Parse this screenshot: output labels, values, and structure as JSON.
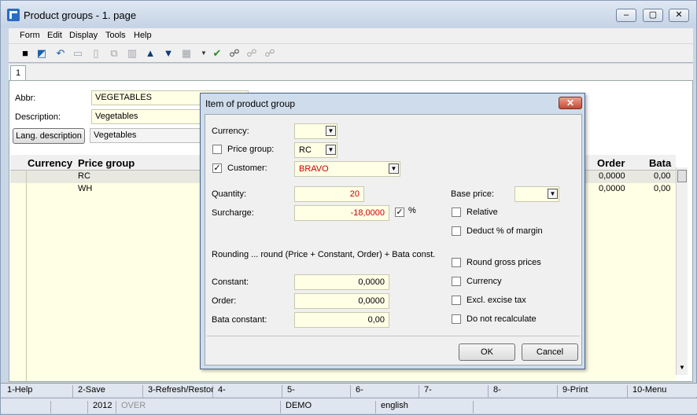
{
  "window": {
    "title": "Product groups - 1. page"
  },
  "menu": [
    "Form",
    "Edit",
    "Display",
    "Tools",
    "Help"
  ],
  "tab": "1",
  "form": {
    "abbr_label": "Abbr:",
    "abbr_value": "VEGETABLES",
    "description_label": "Description:",
    "description_value": "Vegetables",
    "lang_button": "Lang. description",
    "lang_value": "Vegetables"
  },
  "grid": {
    "columns": {
      "currency": "Currency",
      "price_group": "Price group",
      "order": "Order",
      "bata": "Bata"
    },
    "rows": [
      {
        "price_group": "RC",
        "order": "0,0000",
        "bata": "0,00"
      },
      {
        "price_group": "WH",
        "order": "0,0000",
        "bata": "0,00"
      }
    ]
  },
  "dialog": {
    "title": "Item of product group",
    "currency_label": "Currency:",
    "currency_value": "",
    "price_group_label": "Price group:",
    "price_group_value": "RC",
    "customer_label": "Customer:",
    "customer_value": "BRAVO",
    "quantity_label": "Quantity:",
    "quantity_value": "20",
    "surcharge_label": "Surcharge:",
    "surcharge_value": "-18,0000",
    "base_price_label": "Base price:",
    "relative_label": "Relative",
    "deduct_label": "Deduct % of margin",
    "rounding_text": "Rounding ... round (Price + Constant, Order) + Bata const.",
    "constant_label": "Constant:",
    "constant_value": "0,0000",
    "order_label": "Order:",
    "order_value": "0,0000",
    "bata_label": "Bata constant:",
    "bata_value": "0,00",
    "round_gross_label": "Round gross prices",
    "currency_chk_label": "Currency",
    "excise_label": "Excl. excise tax",
    "recalc_label": "Do not recalculate",
    "ok": "OK",
    "cancel": "Cancel"
  },
  "fkeys": [
    "1-Help",
    "2-Save",
    "3-Refresh/Restor",
    "4-",
    "5-",
    "6-",
    "7-",
    "8-",
    "9-Print",
    "10-Menu"
  ],
  "status": {
    "year": "2012",
    "mode": "OVER",
    "db": "DEMO",
    "lang": "english"
  },
  "colors": {
    "red_text": "#cc0000",
    "field_bg": "#ffffe6"
  }
}
